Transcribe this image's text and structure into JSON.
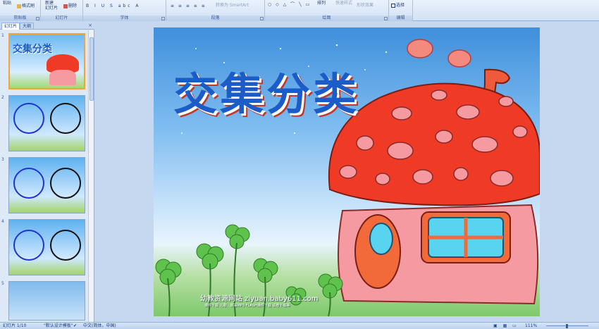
{
  "ribbon": {
    "groups": {
      "clipboard": "剪贴板",
      "slides": "幻灯片",
      "font": "字体",
      "paragraph": "段落",
      "drawing": "绘图",
      "editing": "编辑"
    },
    "paste_label": "粘贴",
    "format_painter_label": "格式刷",
    "new_slide_label": "新建\n幻灯片",
    "delete_label": "删除",
    "convert_smartart_label": "转换为 SmartArt",
    "arrange_label": "排列",
    "quick_styles_label": "快速样式",
    "shape_effects_label": "形状效果",
    "select_label": "选择"
  },
  "pane": {
    "tabs": [
      "幻灯片",
      "大纲"
    ],
    "close": "×",
    "slide_numbers": [
      "1",
      "2",
      "3",
      "4",
      "5"
    ],
    "thumb1_title": "交集分类"
  },
  "slide": {
    "title": "交集分类",
    "site_name": "幼教资源网站  ziyuan.baby611.com",
    "site_sub": "课件下载   儿歌、故事MP3   FLASH课件下载   试卷下载等"
  },
  "status": {
    "slide_position": "幻灯片 1/10",
    "theme": "\"默认设计模板\"",
    "language": "中文(简体，中国)",
    "zoom": "111%"
  },
  "colors": {
    "ribbon_bg": "#dfeaf8",
    "title_blue": "#1b5cc9",
    "mushroom_red": "#ef3b25",
    "house_pink": "#f49aa0",
    "selection_orange": "#f6a33c"
  }
}
